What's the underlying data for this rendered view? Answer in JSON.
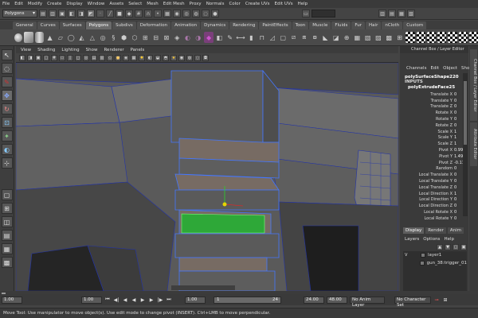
{
  "menubar": [
    "File",
    "Edit",
    "Modify",
    "Create",
    "Display",
    "Window",
    "Assets",
    "Select",
    "Mesh",
    "Edit Mesh",
    "Proxy",
    "Normals",
    "Color",
    "Create UVs",
    "Edit UVs",
    "Help"
  ],
  "statusline": {
    "mode": "Polygons"
  },
  "shelf_tabs": [
    "General",
    "Curves",
    "Surfaces",
    "Polygons",
    "Subdivs",
    "Deformation",
    "Animation",
    "Dynamics",
    "Rendering",
    "PaintEffects",
    "Toon",
    "Muscle",
    "Fluids",
    "Fur",
    "Hair",
    "nCloth",
    "Custom"
  ],
  "shelf_active": "Polygons",
  "panel_menu": [
    "View",
    "Shading",
    "Lighting",
    "Show",
    "Renderer",
    "Panels"
  ],
  "channel_box": {
    "header": "Channel Box / Layer Editor",
    "menu": [
      "Channels",
      "Edit",
      "Object",
      "Show"
    ],
    "shape": "polySurfaceShape220",
    "inputs": "INPUTS",
    "node": "polyExtrudeFace25",
    "attrs": [
      {
        "label": "Translate X",
        "value": "0"
      },
      {
        "label": "Translate Y",
        "value": "0"
      },
      {
        "label": "Translate Z",
        "value": "0"
      },
      {
        "label": "Rotate X",
        "value": "0"
      },
      {
        "label": "Rotate Y",
        "value": "0"
      },
      {
        "label": "Rotate Z",
        "value": "0"
      },
      {
        "label": "Scale X",
        "value": "1"
      },
      {
        "label": "Scale Y",
        "value": "1"
      },
      {
        "label": "Scale Z",
        "value": "1"
      },
      {
        "label": "Pivot X",
        "value": "0.999"
      },
      {
        "label": "Pivot Y",
        "value": "1.498"
      },
      {
        "label": "Pivot Z",
        "value": "-0.11"
      },
      {
        "label": "Random",
        "value": "0"
      },
      {
        "label": "Local Translate X",
        "value": "0"
      },
      {
        "label": "Local Translate Y",
        "value": "0"
      },
      {
        "label": "Local Translate Z",
        "value": "0"
      },
      {
        "label": "Local Direction X",
        "value": "1"
      },
      {
        "label": "Local Direction Y",
        "value": "0"
      },
      {
        "label": "Local Direction Z",
        "value": "0"
      },
      {
        "label": "Local Rotate X",
        "value": "0"
      },
      {
        "label": "Local Rotate Y",
        "value": "0"
      }
    ]
  },
  "layer_editor": {
    "tabs": [
      "Display",
      "Render",
      "Anim"
    ],
    "active_tab": "Display",
    "menu": [
      "Layers",
      "Options",
      "Help"
    ],
    "layers": [
      {
        "visible": "V",
        "name": "layer1"
      },
      {
        "visible": "",
        "name": "gun_38:trigger_01"
      }
    ]
  },
  "side_tabs": [
    "Channel Box / Layer Editor",
    "Attribute Editor"
  ],
  "time": {
    "start": "1.00",
    "current": "1.00",
    "range_start": "1.00",
    "range_frame": "1",
    "range_mark": "24",
    "range_end_field": "24.00",
    "end": "48.00",
    "anim_layer": "No Anim Layer",
    "char_set": "No Character Set"
  },
  "help_line": "Move Tool: Use manipulator to move object(s). Use edit mode to change pivot (INSERT). Ctrl+LMB to move perpendicular."
}
